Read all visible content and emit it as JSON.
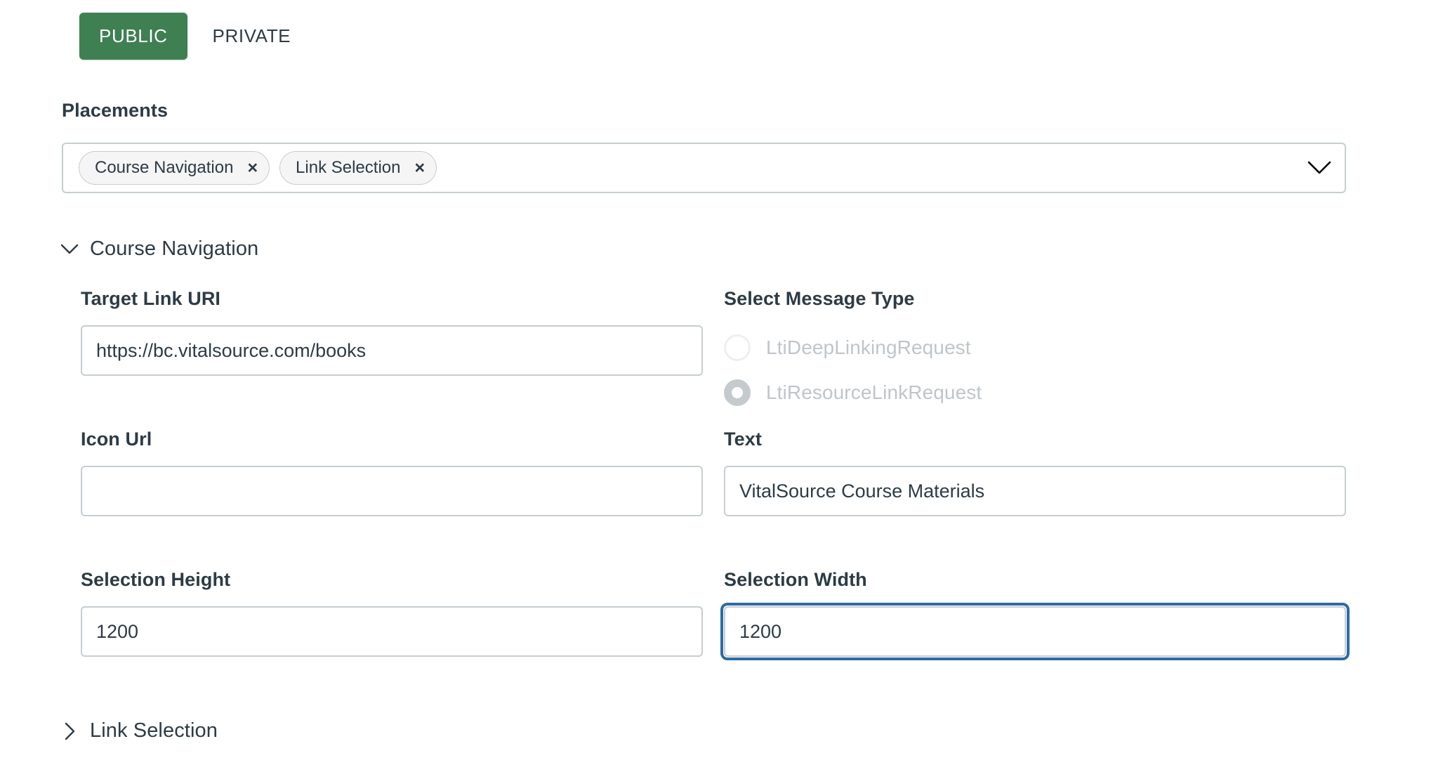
{
  "visibility_tabs": {
    "items": [
      {
        "label": "PUBLIC",
        "active": true
      },
      {
        "label": "PRIVATE",
        "active": false
      }
    ],
    "public_label": "PUBLIC",
    "private_label": "PRIVATE",
    "active_color": "#3e8052"
  },
  "placements": {
    "label": "Placements",
    "chips": [
      {
        "label": "Course Navigation",
        "remove": "×"
      },
      {
        "label": "Link Selection",
        "remove": "×"
      }
    ],
    "chip_0_label": "Course Navigation",
    "chip_1_label": "Link Selection",
    "remove_glyph": "×",
    "caret_icon": "chevron-down-icon"
  },
  "sections": [
    {
      "title": "Course Navigation",
      "expanded": true,
      "caret_icon": "chevron-down-icon"
    },
    {
      "title": "Link Selection",
      "expanded": false,
      "caret_icon": "chevron-right-icon"
    }
  ],
  "course_navigation": {
    "title": "Course Navigation",
    "rows": [
      {
        "left": {
          "label": "Target Link URI",
          "value": "https://bc.vitalsource.com/books",
          "placeholder": "",
          "focused": false
        },
        "right_kind": "radio-group"
      },
      {
        "left": {
          "label": "Icon Url",
          "value": "",
          "placeholder": "",
          "focused": false
        },
        "right": {
          "label": "Text",
          "value": "VitalSource Course Materials",
          "placeholder": "",
          "focused": false
        }
      },
      {
        "left": {
          "label": "Selection Height",
          "value": "1200",
          "placeholder": "",
          "focused": false
        },
        "right": {
          "label": "Selection Width",
          "value": "1200",
          "placeholder": "",
          "focused": true
        }
      }
    ],
    "message_type": {
      "label": "Select Message Type",
      "disabled": true,
      "options": [
        {
          "label": "LtiDeepLinkingRequest",
          "selected": false
        },
        {
          "label": "LtiResourceLinkRequest",
          "selected": true
        }
      ],
      "option_0_label": "LtiDeepLinkingRequest",
      "option_1_label": "LtiResourceLinkRequest",
      "selected_value": "LtiResourceLinkRequest"
    }
  },
  "link_selection": {
    "title": "Link Selection",
    "expanded": false
  },
  "colors": {
    "accent_green": "#3e8052",
    "focus_blue": "#2d6ca4",
    "border_gray": "#c7cdd1",
    "text": "#2d3b45",
    "disabled_text": "#bfc5ca"
  }
}
